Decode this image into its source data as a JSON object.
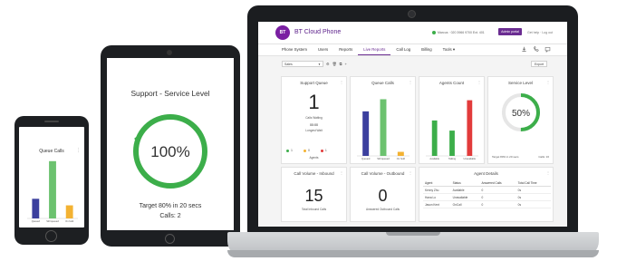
{
  "phone": {
    "card_title": "Queue Calls",
    "chart_data": {
      "type": "bar",
      "categories": [
        "Queued",
        "Still queued",
        "On hold"
      ],
      "values": [
        12,
        35,
        8
      ],
      "colors": [
        "#3b3f9e",
        "#6cc26f",
        "#f3b232"
      ]
    }
  },
  "tablet": {
    "title": "Support - Service Level",
    "percent_label": "100%",
    "percent": 100,
    "target_text": "Target 80% in 20 secs",
    "calls_text": "Calls: 2",
    "ring_color": "#3cae4a"
  },
  "laptop": {
    "brand": "BT Cloud Phone",
    "logo": "BT",
    "status_text": "Marcus · 020 3966 9700 Ext. 401",
    "admin_button": "Admin portal",
    "header_links": "Get help · Log out",
    "tabs": [
      "Phone System",
      "Users",
      "Reports",
      "Live Reports",
      "Call Log",
      "Billing",
      "Tools ▾"
    ],
    "active_tab": "Live Reports",
    "nav_icons": [
      "download-icon",
      "phone-icon",
      "chat-icon"
    ],
    "view_select": "Sales",
    "export_label": "Export",
    "cards": {
      "support_queue": {
        "title": "Support Queue",
        "value": "1",
        "caption": "Calls Waiting",
        "wait_time": "00:00",
        "wait_caption": "Longest Wait",
        "agents_caption": "Agents",
        "status_counts": [
          {
            "label": "1",
            "color": "#3cae4a"
          },
          {
            "label": "0",
            "color": "#f3b232"
          },
          {
            "label": "1",
            "color": "#e23b3b"
          }
        ]
      },
      "queue_calls": {
        "title": "Queue Calls",
        "chart_data": {
          "type": "bar",
          "categories": [
            "Queued",
            "Still queued",
            "On hold"
          ],
          "values": [
            22,
            28,
            2
          ],
          "colors": [
            "#3b3f9e",
            "#6cc26f",
            "#f3b232"
          ]
        }
      },
      "agents_count": {
        "title": "Agents Count",
        "chart_data": {
          "type": "bar",
          "categories": [
            "Available",
            "Talking",
            "Unavailable"
          ],
          "values": [
            14,
            10,
            22
          ],
          "colors": [
            "#3cae4a",
            "#3cae4a",
            "#e23b3b"
          ]
        }
      },
      "service_level": {
        "title": "Service Level",
        "percent_label": "50%",
        "percent": 50,
        "target_text": "Target 80% in 20 secs",
        "calls_text": "Calls: 16"
      },
      "inbound": {
        "title": "Call Volume - Inbound",
        "value": "15",
        "caption": "Total Inbound Calls"
      },
      "outbound": {
        "title": "Call Volume - Outbound",
        "value": "0",
        "caption": "Answered Outbound Calls"
      },
      "agent_details": {
        "title": "Agent Details",
        "columns": [
          "Agent",
          "Status",
          "Answered Calls",
          "Total Call Time"
        ],
        "rows": [
          [
            "Kenny Zhu",
            "Available",
            "0",
            "0s"
          ],
          [
            "Hana Lo",
            "Unavailable",
            "0",
            "0s"
          ],
          [
            "Jason Kent",
            "OnCall",
            "0",
            "0s"
          ]
        ]
      }
    }
  }
}
